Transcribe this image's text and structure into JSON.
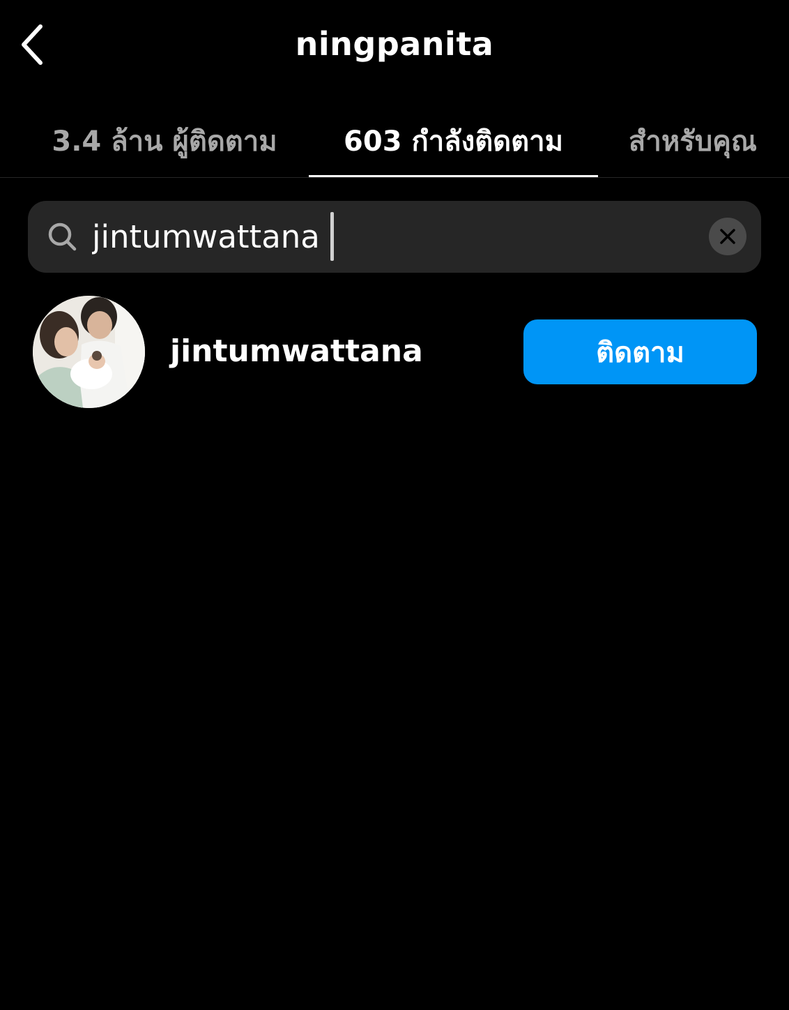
{
  "header": {
    "title": "ningpanita",
    "back_icon": "chevron-left-icon"
  },
  "tabs": [
    {
      "label": "3.4 ล้าน ผู้ติดตาม",
      "active": false
    },
    {
      "label": "603 กำลังติดตาม",
      "active": true
    },
    {
      "label": "สำหรับคุณ",
      "active": false
    }
  ],
  "search": {
    "value": "jintumwattana",
    "icon": "search-icon",
    "clear_icon": "clear-icon"
  },
  "results": [
    {
      "username": "jintumwattana",
      "button_label": "ติดตาม",
      "avatar": "avatar-photo"
    }
  ],
  "colors": {
    "background": "#000000",
    "accent": "#0095f6",
    "inactive_text": "#a8a8a8",
    "search_bg": "#262626"
  }
}
